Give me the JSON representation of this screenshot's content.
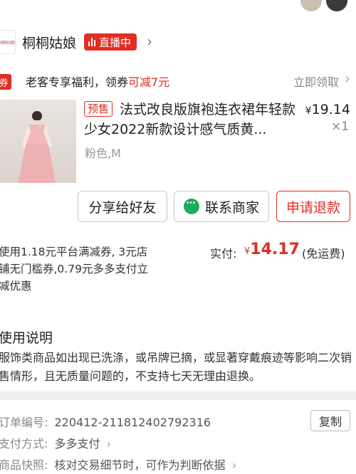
{
  "shop": {
    "logo_text": "桐桐姑娘",
    "name": "桐桐姑娘",
    "live_label": "直播中"
  },
  "coupon": {
    "tag": "券",
    "text_prefix": "老客专享福利，领券",
    "text_highlight": "可减7元",
    "claim_label": "立即领取"
  },
  "product": {
    "presale_tag": "预售",
    "title": "法式改良版旗袍连衣裙年轻款少女2022新款设计感气质黄...",
    "price_symbol": "¥",
    "price": "19.14",
    "quantity": "×1",
    "spec": "粉色,M"
  },
  "actions": {
    "share_label": "分享给好友",
    "contact_label": "联系商家",
    "refund_label": "申请退款"
  },
  "payment": {
    "discount_text": "使用1.18元平台满减券, 3元店铺无门槛券,0.79元多多支付立减优惠",
    "paid_label": "实付:",
    "paid_symbol": "¥",
    "paid_amount": "14.17",
    "shipping_note": "(免运费)"
  },
  "instructions": {
    "title": "使用说明",
    "body": "服饰类商品如出现已洗涤，或吊牌已摘，或显著穿戴痕迹等影响二次销售情形，且无质量问题的，不支持七天无理由退换。"
  },
  "order": {
    "number_label": "订单编号:",
    "number_value": "220412-211812402792316",
    "copy_label": "复制",
    "pay_method_label": "支付方式:",
    "pay_method_value": "多多支付",
    "snapshot_label": "商品快照:",
    "snapshot_value": "核对交易细节时，可作为判断依据"
  },
  "colors": {
    "accent": "#e02e24",
    "wechat_green": "#1aad5a"
  }
}
